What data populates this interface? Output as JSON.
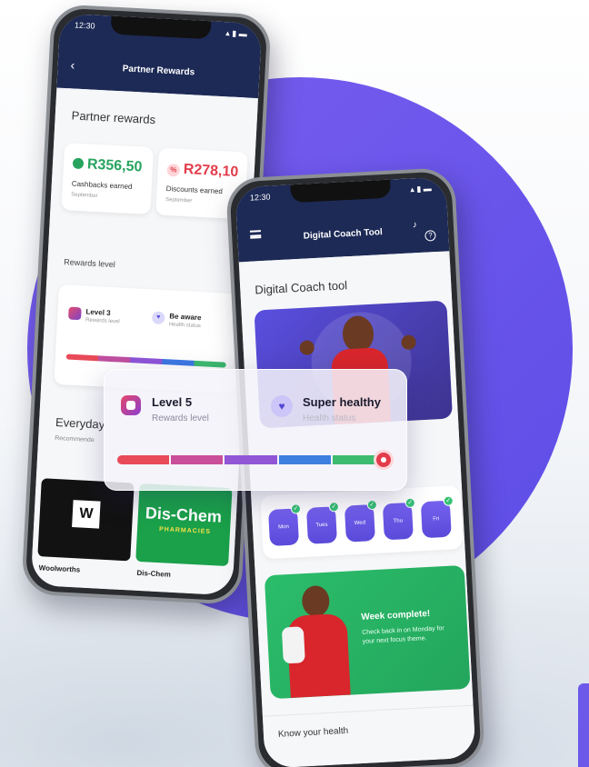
{
  "left_phone": {
    "time": "12:30",
    "nav_title": "Partner Rewards",
    "section_title": "Partner rewards",
    "cashback": {
      "value": "R356,50",
      "label": "Cashbacks earned",
      "period": "September"
    },
    "discount": {
      "value": "R278,10",
      "label": "Discounts earned",
      "period": "September"
    },
    "rewards_level_heading": "Rewards level",
    "level": {
      "label": "Level 3",
      "sub": "Rewards level"
    },
    "health": {
      "label": "Be aware",
      "sub": "Health status"
    },
    "everyday_heading": "Everyday",
    "recommended": "Recommende",
    "partners": [
      {
        "name": "Woolworths",
        "logo": "W"
      },
      {
        "name": "Dis-Chem",
        "logo": "Dis-Chem",
        "logo_sub": "PHARMACIES"
      }
    ]
  },
  "right_phone": {
    "time": "12:30",
    "nav_title": "Digital Coach Tool",
    "section_title": "Digital Coach tool",
    "days": [
      "Mon",
      "Tues",
      "Wed",
      "Thu",
      "Fri"
    ],
    "week_complete_title": "Week complete!",
    "week_complete_text": "Check back in on Monday for your next focus theme.",
    "bottom_heading": "Know your health"
  },
  "overlay_card": {
    "level_label": "Level 5",
    "level_sub": "Rewards level",
    "health_label": "Super healthy",
    "health_sub": "Health status",
    "bar_colors": [
      "#e84a58",
      "#c94f99",
      "#9056d6",
      "#3d7fe0",
      "#3dbb6e"
    ]
  },
  "colors": {
    "brand_navy": "#1d2a56",
    "circle_purple": "#6b55ea",
    "cashback_green": "#27a35e",
    "discount_red": "#e23c4a"
  }
}
